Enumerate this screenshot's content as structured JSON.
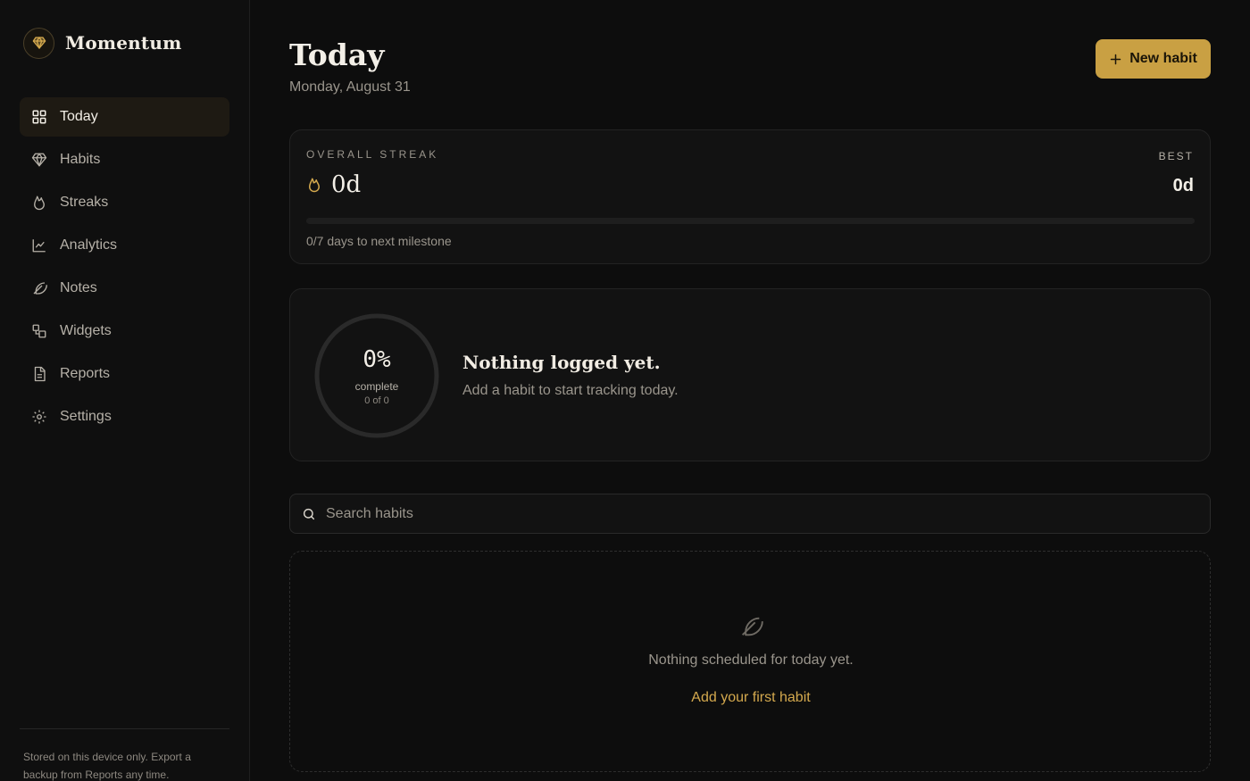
{
  "brand": {
    "name": "Momentum",
    "icon": "gem-icon",
    "accent": "#c9a043"
  },
  "sidebar": {
    "items": [
      {
        "label": "Today",
        "icon": "grid-icon",
        "active": true
      },
      {
        "label": "Habits",
        "icon": "gem-icon",
        "active": false
      },
      {
        "label": "Streaks",
        "icon": "flame-icon",
        "active": false
      },
      {
        "label": "Analytics",
        "icon": "chart-line-icon",
        "active": false
      },
      {
        "label": "Notes",
        "icon": "feather-icon",
        "active": false
      },
      {
        "label": "Widgets",
        "icon": "widgets-icon",
        "active": false
      },
      {
        "label": "Reports",
        "icon": "document-icon",
        "active": false
      },
      {
        "label": "Settings",
        "icon": "gear-icon",
        "active": false
      }
    ],
    "footer": "Stored on this device only. Export a backup from Reports any time."
  },
  "header": {
    "title": "Today",
    "date": "Monday, August 31",
    "new_habit_label": "New habit"
  },
  "streak": {
    "label": "OVERALL STREAK",
    "value": "0d",
    "best_label": "BEST",
    "best_value": "0d",
    "progress": 0,
    "milestone_text": "0/7 days to next milestone"
  },
  "today_summary": {
    "percent": "0%",
    "percent_value": 0,
    "complete_label": "complete",
    "count": "0 of 0",
    "title": "Nothing logged yet.",
    "subtitle": "Add a habit to start tracking today."
  },
  "search": {
    "placeholder": "Search habits",
    "value": ""
  },
  "empty_state": {
    "icon": "feather-icon",
    "message": "Nothing scheduled for today yet.",
    "cta": "Add your first habit"
  }
}
